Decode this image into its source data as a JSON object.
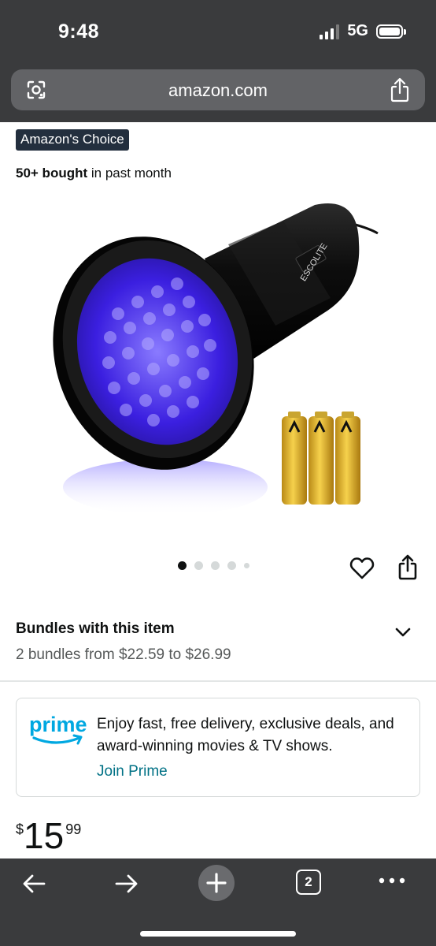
{
  "status_bar": {
    "time": "9:48",
    "network": "5G"
  },
  "browser": {
    "url": "amazon.com",
    "icons": [
      "google-lens-icon",
      "share-icon"
    ]
  },
  "product": {
    "badge": "Amazon's Choice",
    "bought_count": "50+ bought",
    "bought_suffix": " in past month",
    "image_carousel": {
      "total_images": 5,
      "active_index": 0
    },
    "actions": [
      "heart-icon",
      "share-icon"
    ]
  },
  "bundles": {
    "title": "Bundles with this item",
    "subtitle": "2 bundles from $22.59 to $26.99"
  },
  "prime": {
    "logo_text": "prime",
    "message": "Enjoy fast, free delivery, exclusive deals, and award-winning movies & TV shows.",
    "join_label": "Join Prime",
    "accent_color": "#007185"
  },
  "price": {
    "symbol": "$",
    "whole": "15",
    "fraction": "99"
  },
  "toolbar": {
    "tab_count": "2",
    "buttons": [
      "back-icon",
      "forward-icon",
      "new-tab-icon",
      "tabs-icon",
      "more-icon"
    ]
  },
  "colors": {
    "chrome": "#3a3b3d",
    "badge_bg": "#232f3e",
    "prime_blue": "#00a8e1",
    "link": "#007185"
  }
}
